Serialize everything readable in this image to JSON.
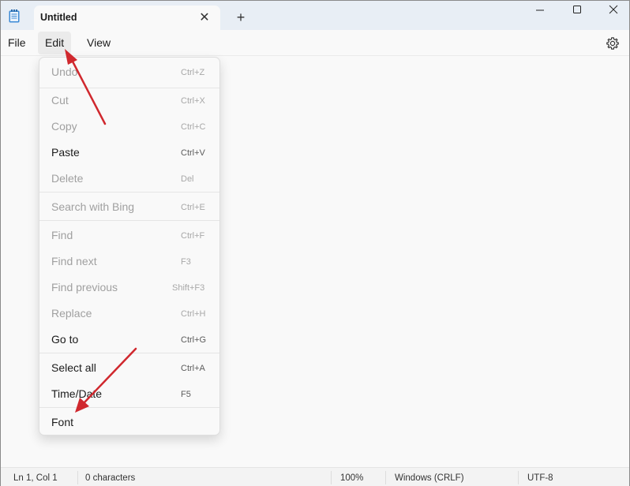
{
  "window": {
    "tab_title": "Untitled",
    "tab_close_glyph": "✕",
    "new_tab_glyph": "+"
  },
  "menubar": {
    "file": "File",
    "edit": "Edit",
    "view": "View"
  },
  "edit_menu": {
    "items": [
      {
        "label": "Undo",
        "shortcut": "Ctrl+Z",
        "enabled": false
      },
      {
        "label": "Cut",
        "shortcut": "Ctrl+X",
        "enabled": false
      },
      {
        "label": "Copy",
        "shortcut": "Ctrl+C",
        "enabled": false
      },
      {
        "label": "Paste",
        "shortcut": "Ctrl+V",
        "enabled": true
      },
      {
        "label": "Delete",
        "shortcut": "Del",
        "enabled": false
      },
      {
        "label": "Search with Bing",
        "shortcut": "Ctrl+E",
        "enabled": false
      },
      {
        "label": "Find",
        "shortcut": "Ctrl+F",
        "enabled": false
      },
      {
        "label": "Find next",
        "shortcut": "F3",
        "enabled": false
      },
      {
        "label": "Find previous",
        "shortcut": "Shift+F3",
        "enabled": false
      },
      {
        "label": "Replace",
        "shortcut": "Ctrl+H",
        "enabled": false
      },
      {
        "label": "Go to",
        "shortcut": "Ctrl+G",
        "enabled": true
      },
      {
        "label": "Select all",
        "shortcut": "Ctrl+A",
        "enabled": true
      },
      {
        "label": "Time/Date",
        "shortcut": "F5",
        "enabled": true
      },
      {
        "label": "Font",
        "shortcut": "",
        "enabled": true
      }
    ]
  },
  "statusbar": {
    "position": "Ln 1, Col 1",
    "characters": "0 characters",
    "zoom": "100%",
    "line_ending": "Windows (CRLF)",
    "encoding": "UTF-8"
  },
  "colors": {
    "annotation_arrow": "#d0282e",
    "titlebar": "#e8eef5"
  },
  "icons": {
    "app": "notepad-icon",
    "settings": "gear-icon"
  }
}
